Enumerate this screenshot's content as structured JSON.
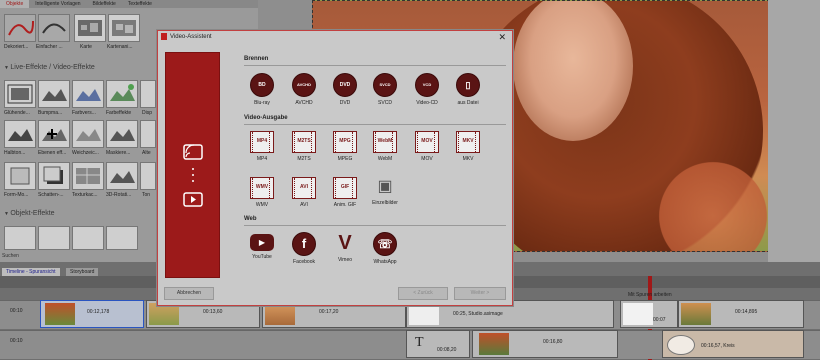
{
  "left_panel": {
    "tabs": [
      "Objekte",
      "Intelligente Vorlagen",
      "Bildeffekte",
      "Texteffekte"
    ],
    "row1_labels": [
      "Dekoriert...",
      "Einfacher ...",
      "Karte",
      "Kartenani..."
    ],
    "section_live": "Live-Effekte / Video-Effekte",
    "row2_labels": [
      "Glühende...",
      "Bumpma...",
      "Farbvers...",
      "Farbeffekte",
      "Disp"
    ],
    "row3_labels": [
      "Halbton...",
      "Ebenen eff...",
      "Weichzeic...",
      "Maskiere...",
      "Alte"
    ],
    "row4_labels": [
      "Form-Mo...",
      "Schatten-...",
      "Texturkac...",
      "3D-Rotati...",
      "Ton"
    ],
    "section_obj": "Objekt-Effekte",
    "search": "Suchen"
  },
  "dialog": {
    "title": "Video-Assistent",
    "close": "✕",
    "brennen": "Brennen",
    "brennen_items": [
      {
        "icon": "BD",
        "label": "Blu-ray"
      },
      {
        "icon": "AVCHD",
        "label": "AVCHD"
      },
      {
        "icon": "DVD",
        "label": "DVD"
      },
      {
        "icon": "SVCD",
        "label": "SVCD"
      },
      {
        "icon": "VCD",
        "label": "Video-CD"
      },
      {
        "icon": "▯",
        "label": "aus Datei"
      }
    ],
    "video_ausgabe": "Video-Ausgabe",
    "video_items_row1": [
      {
        "icon": "MP4",
        "label": "MP4"
      },
      {
        "icon": "M2TS",
        "label": "M2TS"
      },
      {
        "icon": "MPG",
        "label": "MPEG"
      },
      {
        "icon": "WebM",
        "label": "WebM"
      },
      {
        "icon": "MOV",
        "label": "MOV"
      },
      {
        "icon": "MKV",
        "label": "MKV"
      }
    ],
    "video_items_row2": [
      {
        "icon": "WMV",
        "label": "WMV"
      },
      {
        "icon": "AVI",
        "label": "AVI"
      },
      {
        "icon": "GIF",
        "label": "Anim. GIF"
      },
      {
        "icon": "▣",
        "label": "Einzelbilder"
      }
    ],
    "web": "Web",
    "web_items": [
      {
        "icon": "▶",
        "label": "YouTube"
      },
      {
        "icon": "f",
        "label": "Facebook"
      },
      {
        "icon": "V",
        "label": "Vimeo"
      },
      {
        "icon": "☏",
        "label": "WhatsApp"
      }
    ],
    "cancel": "Abbrechen",
    "back": "< Zurück",
    "next": "Weiter >"
  },
  "timeline": {
    "tab1": "Timeline - Spuransicht",
    "tab2": "Storyboard",
    "track_labels": [
      "00:10",
      "00:10"
    ],
    "clips": [
      {
        "time": "00:12,178"
      },
      {
        "time": "00:13,60"
      },
      {
        "time": "00:17,20"
      },
      {
        "time": "00:25, Studio.asimage"
      },
      {
        "time": "00:16,80"
      },
      {
        "time": "00:08,20"
      },
      {
        "time": "00:07"
      },
      {
        "time": "00:14,895"
      },
      {
        "time": "00:16,57, Kreis"
      }
    ],
    "spur_label": "Mit Spuren arbeiten"
  },
  "colors": {
    "accent": "#9c1a1a",
    "dialog_bg": "#c9c9c9"
  }
}
